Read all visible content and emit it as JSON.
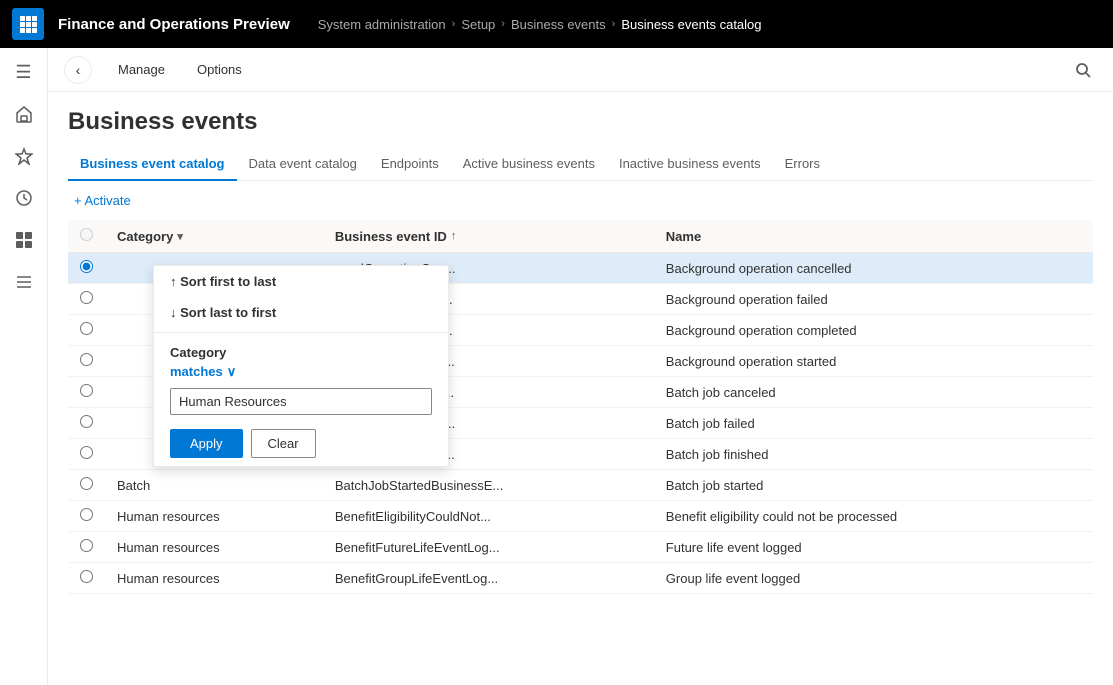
{
  "app": {
    "title": "Finance and Operations Preview",
    "grid_icon": "⊞"
  },
  "breadcrumb": {
    "items": [
      {
        "label": "System administration"
      },
      {
        "label": "Setup"
      },
      {
        "label": "Business events"
      },
      {
        "label": "Business events catalog"
      }
    ]
  },
  "action_bar": {
    "back_label": "←",
    "manage_label": "Manage",
    "options_label": "Options"
  },
  "page": {
    "title": "Business events"
  },
  "tabs": [
    {
      "label": "Business event catalog",
      "active": true
    },
    {
      "label": "Data event catalog",
      "active": false
    },
    {
      "label": "Endpoints",
      "active": false
    },
    {
      "label": "Active business events",
      "active": false
    },
    {
      "label": "Inactive business events",
      "active": false
    },
    {
      "label": "Errors",
      "active": false
    }
  ],
  "toolbar": {
    "activate_label": "+ Activate"
  },
  "table": {
    "columns": [
      {
        "id": "radio",
        "label": ""
      },
      {
        "id": "category",
        "label": "Category"
      },
      {
        "id": "event_id",
        "label": "Business event ID"
      },
      {
        "id": "name",
        "label": "Name"
      }
    ],
    "rows": [
      {
        "radio": true,
        "category": "",
        "event_id": "oundOperationCan...",
        "name": "Background operation cancelled",
        "selected": true
      },
      {
        "radio": false,
        "category": "",
        "event_id": "oundOperationFail...",
        "name": "Background operation failed",
        "selected": false
      },
      {
        "radio": false,
        "category": "",
        "event_id": "oundOperationFini...",
        "name": "Background operation completed",
        "selected": false
      },
      {
        "radio": false,
        "category": "",
        "event_id": "oundOperationStar...",
        "name": "Background operation started",
        "selected": false
      },
      {
        "radio": false,
        "category": "",
        "event_id": "bCanceledBusines...",
        "name": "Batch job canceled",
        "selected": false
      },
      {
        "radio": false,
        "category": "",
        "event_id": "bFailedBusinessEv...",
        "name": "Batch job failed",
        "selected": false
      },
      {
        "radio": false,
        "category": "",
        "event_id": "bFinishedBusiness...",
        "name": "Batch job finished",
        "selected": false
      },
      {
        "radio": false,
        "category": "Batch",
        "event_id": "BatchJobStartedBusinessE...",
        "name": "Batch job started",
        "selected": false
      },
      {
        "radio": false,
        "category": "Human resources",
        "event_id": "BenefitEligibilityCouldNot...",
        "name": "Benefit eligibility could not be processed",
        "selected": false
      },
      {
        "radio": false,
        "category": "Human resources",
        "event_id": "BenefitFutureLifeEventLog...",
        "name": "Future life event logged",
        "selected": false
      },
      {
        "radio": false,
        "category": "Human resources",
        "event_id": "BenefitGroupLifeEventLog...",
        "name": "Group life event logged",
        "selected": false
      }
    ]
  },
  "dropdown": {
    "sort_asc_label": "↑ Sort first to last",
    "sort_desc_label": "↓ Sort last to first",
    "filter_label": "Category",
    "matches_label": "matches",
    "chevron": "∨",
    "input_value": "Human Resources",
    "apply_label": "Apply",
    "clear_label": "Clear"
  },
  "nav_icons": [
    {
      "name": "hamburger-icon",
      "glyph": "☰"
    },
    {
      "name": "home-icon",
      "glyph": "⌂"
    },
    {
      "name": "favorites-icon",
      "glyph": "☆"
    },
    {
      "name": "recent-icon",
      "glyph": "🕐"
    },
    {
      "name": "workspaces-icon",
      "glyph": "⊞"
    },
    {
      "name": "list-icon",
      "glyph": "≡"
    }
  ]
}
